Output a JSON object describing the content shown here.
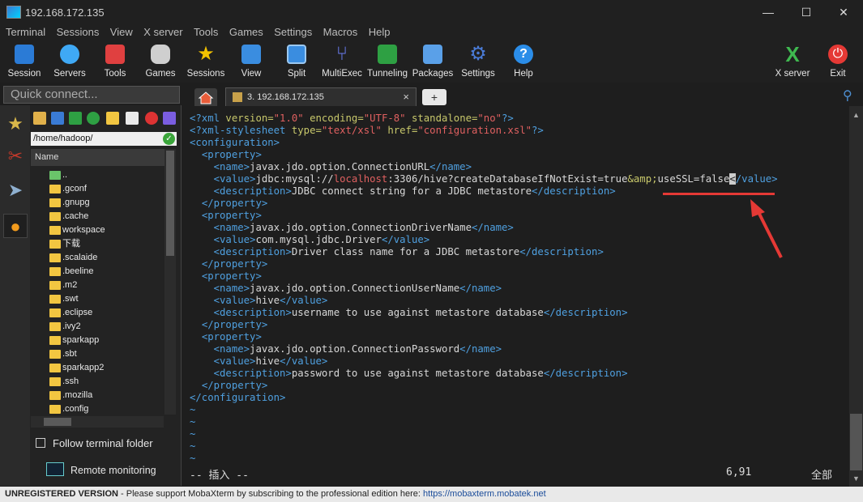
{
  "window": {
    "title": "192.168.172.135"
  },
  "menu": [
    "Terminal",
    "Sessions",
    "View",
    "X server",
    "Tools",
    "Games",
    "Settings",
    "Macros",
    "Help"
  ],
  "toolbar": {
    "items": [
      {
        "label": "Session",
        "icon": "session-icon",
        "color": "#2b7bd6"
      },
      {
        "label": "Servers",
        "icon": "servers-icon",
        "color": "#3fa9f5"
      },
      {
        "label": "Tools",
        "icon": "tools-icon",
        "color": "#e04040"
      },
      {
        "label": "Games",
        "icon": "games-icon",
        "color": "#cfcfcf"
      },
      {
        "label": "Sessions",
        "icon": "star-icon",
        "color": "#f2c200"
      },
      {
        "label": "View",
        "icon": "view-icon",
        "color": "#3a8de0"
      },
      {
        "label": "Split",
        "icon": "split-icon",
        "color": "#3a8de0"
      },
      {
        "label": "MultiExec",
        "icon": "multiexec-icon",
        "color": "#5a6de0"
      },
      {
        "label": "Tunneling",
        "icon": "tunneling-icon",
        "color": "#2ea043"
      },
      {
        "label": "Packages",
        "icon": "packages-icon",
        "color": "#5aa0e8"
      },
      {
        "label": "Settings",
        "icon": "settings-icon",
        "color": "#4a7bd6"
      },
      {
        "label": "Help",
        "icon": "help-icon",
        "color": "#2b8de8"
      }
    ],
    "xserver_label": "X server",
    "exit_label": "Exit"
  },
  "quick_connect": {
    "placeholder": "Quick connect..."
  },
  "tabs": {
    "session_tab_label": "3. 192.168.172.135",
    "close_glyph": "×",
    "new_tab_glyph": "+"
  },
  "browser": {
    "path": "/home/hadoop/",
    "column_header": "Name",
    "files": [
      "..",
      ".gconf",
      ".gnupg",
      ".cache",
      "workspace",
      "下载",
      ".scalaide",
      ".beeline",
      ".m2",
      ".swt",
      ".eclipse",
      ".ivy2",
      "sparkapp",
      ".sbt",
      "sparkapp2",
      ".ssh",
      ".mozilla",
      ".config"
    ],
    "follow_label": "Follow terminal folder",
    "remote_label": "Remote monitoring"
  },
  "terminal": {
    "xml_decl": {
      "version": "\"1.0\"",
      "encoding": "\"UTF-8\"",
      "standalone": "\"no\""
    },
    "xml_style": {
      "type": "\"text/xsl\"",
      "href": "\"configuration.xsl\""
    },
    "properties": [
      {
        "name": "javax.jdo.option.ConnectionURL",
        "value_prefix": "jdbc:mysql://",
        "value_host": "localhost",
        "value_rest": ":3306/hive?createDatabaseIfNotExist=true",
        "value_entity": "&amp;",
        "value_tail": "useSSL=false",
        "description": "JDBC connect string for a JDBC metastore"
      },
      {
        "name": "javax.jdo.option.ConnectionDriverName",
        "value": "com.mysql.jdbc.Driver",
        "description": "Driver class name for a JDBC metastore"
      },
      {
        "name": "javax.jdo.option.ConnectionUserName",
        "value": "hive",
        "description": "username to use against metastore database"
      },
      {
        "name": "javax.jdo.option.ConnectionPassword",
        "value": "hive",
        "description": "password to use against metastore database"
      }
    ],
    "mode": "-- 插入 --",
    "position": "6,91",
    "scope": "全部"
  },
  "status": {
    "unregistered": "UNREGISTERED VERSION",
    "message": " -  Please support MobaXterm by subscribing to the professional edition here:  ",
    "link": "https://mobaxterm.mobatek.net"
  }
}
